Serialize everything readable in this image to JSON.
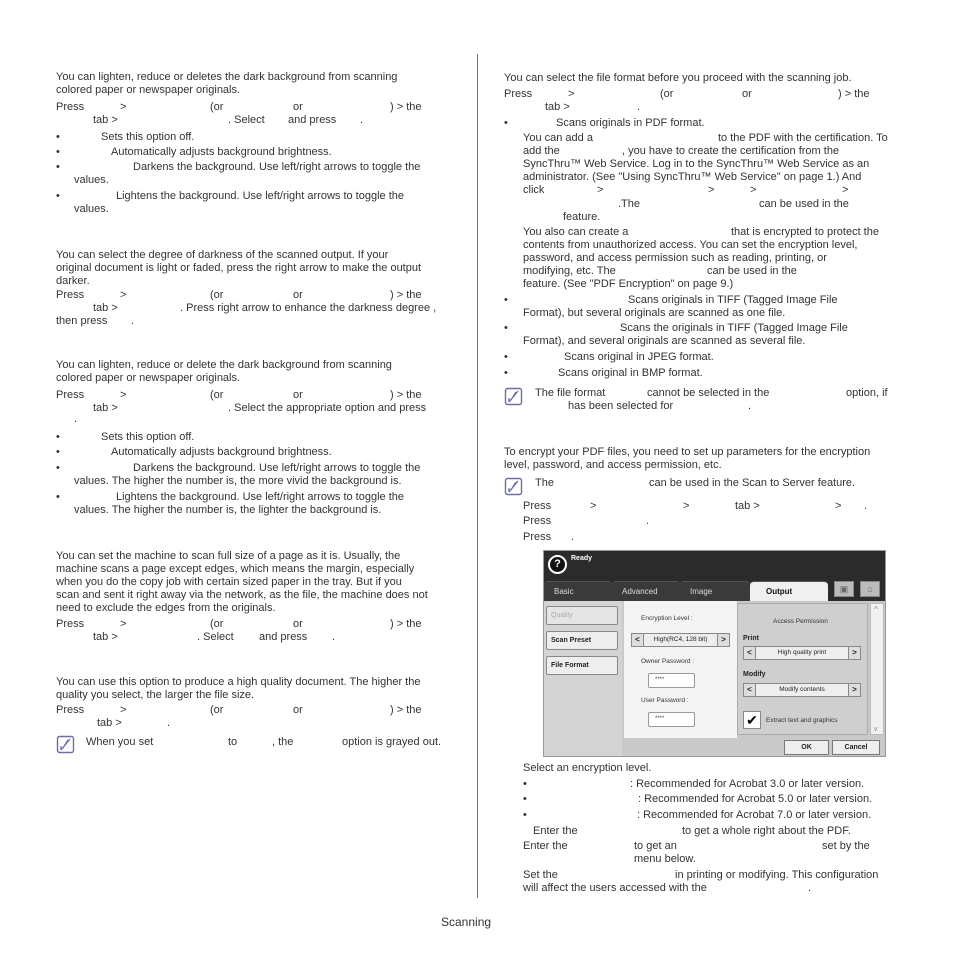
{
  "left": {
    "s1": {
      "intro1": "You can lighten, reduce or deletes the dark background from scanning",
      "intro2": "colored paper or newspaper originals.",
      "press": "Press",
      "gt": ">",
      "or_open": "(or",
      "or": "or",
      "close_the": ") > the",
      "tab_gt": "tab >",
      "select": ". Select",
      "and_press": "and press",
      "dot": ".",
      "b1": "Sets this option off.",
      "b2": "Automatically adjusts background brightness.",
      "b3": "Darkens the background. Use left/right arrows to toggle the",
      "b3b": "values.",
      "b4": "Lightens the background. Use left/right arrows to toggle the",
      "b4b": "values."
    },
    "s2": {
      "intro1": "You can select the degree of darkness of the scanned output. If your",
      "intro2": "original document is light or faded, press the right arrow to make the output",
      "intro3": "darker.",
      "tab_line": ". Press right arrow to enhance the darkness degree ,",
      "then": "then press"
    },
    "s3": {
      "intro1": "You can lighten, reduce or delete the dark background from scanning",
      "intro2": "colored paper or newspaper originals.",
      "tab_line": ". Select the appropriate option and press",
      "b1": "Sets this option off.",
      "b2": "Automatically adjusts background brightness.",
      "b3": "Darkens the background. Use left/right arrows to toggle the",
      "b3b": "values. The higher the number is, the more vivid the background is.",
      "b4": "Lightens the background. Use left/right arrows to toggle the",
      "b4b": "values. The higher the number is, the lighter the background is."
    },
    "s4": {
      "l1": "You can set the machine to scan full size of a page as it is. Usually, the",
      "l2": "machine scans a page except edges, which means the margin, especially",
      "l3": "when you do the copy job with certain sized paper in the tray. But if you",
      "l4": "scan and sent it right away via the network, as the file, the machine does not",
      "l5": "need to exclude the edges from the originals."
    },
    "s5": {
      "l1": "You can use this option to produce a high quality document. The higher the",
      "l2": "quality you select, the larger the file size.",
      "note_a": "When you set",
      "note_b": "to",
      "note_c": ", the",
      "note_d": "option is grayed out."
    }
  },
  "right": {
    "s1": {
      "intro": "You can select the file format before you proceed with the scanning job.",
      "b1": "Scans originals in PDF format.",
      "p1": "You can add a",
      "p1b": "to the PDF with the certification. To",
      "p2": "add the",
      "p2b": ", you have to create the certification from the",
      "p3": "SyncThru™ Web Service. Log in to the SyncThru™ Web Service as an",
      "p4": "administrator. (See \"Using SyncThru™ Web Service\" on page 1.) And",
      "p5": "click",
      "p6a": ".The",
      "p6b": "can be used in the",
      "p7": "feature.",
      "q1a": "You also can create a",
      "q1b": "that is encrypted to protect the",
      "q2": "contents from unauthorized access. You can set the encryption level,",
      "q3": "password, and access permission such as reading, printing, or",
      "q4a": "modifying, etc. The",
      "q4b": "can be used in the",
      "q5": "feature. (See \"PDF Encryption\" on page 9.)",
      "b2": "Scans originals in TIFF (Tagged Image File",
      "b2b": "Format), but several originals are scanned as one file.",
      "b3": "Scans the originals in TIFF (Tagged Image File",
      "b3b": "Format), and several originals are scanned as several file.",
      "b4": "Scans original in JPEG format.",
      "b5": "Scans original in BMP format.",
      "note1a": "The file format",
      "note1b": "cannot be selected in the",
      "note1c": "option, if",
      "note2a": "has been selected for"
    },
    "s2": {
      "l1": "To encrypt your PDF files, you need to set up parameters for the encryption",
      "l2": "level, password, and access permission, etc.",
      "note_a": "The",
      "note_b": "can be used in the Scan to Server feature.",
      "step1_tab": "tab >",
      "step4": "Select an encryption level.",
      "e1": ": Recommended for Acrobat 3.0 or later version.",
      "e2": ": Recommended for Acrobat 5.0 or later version.",
      "e3": ": Recommended for Acrobat 7.0 or later version.",
      "s5a": "Enter the",
      "s5b": "to get a whole right about the PDF.",
      "s6a": "Enter the",
      "s6b": "to get an",
      "s6c": "set by the",
      "s6d": "menu below.",
      "s7a": "Set the",
      "s7b": "in printing or modifying. This configuration",
      "s7c": "will affect the users accessed with the"
    }
  },
  "ui": {
    "status": "Ready",
    "help_glyph": "?",
    "tabs": [
      "Basic",
      "Advanced",
      "Image",
      "Output"
    ],
    "active_tab": "Output",
    "left_buttons": [
      "Quality",
      "Scan Preset",
      "File Format"
    ],
    "encryption_label": "Encryption Level :",
    "encryption_value": "High(RC4, 128 bit)",
    "owner_pw_label": "Owner Password :",
    "owner_pw_value": "****",
    "user_pw_label": "User Password :",
    "user_pw_value": "****",
    "access_title": "Access Permission",
    "print_label": "Print",
    "print_value": "High quality print",
    "modify_label": "Modify",
    "modify_value": "Modify contents",
    "extract_label": "Extract text and graphics",
    "extract_checked": true,
    "ok": "OK",
    "cancel": "Cancel",
    "arrow_left": "<",
    "arrow_right": ">",
    "scroll_up": "^",
    "scroll_down": "v"
  },
  "footer": "Scanning"
}
